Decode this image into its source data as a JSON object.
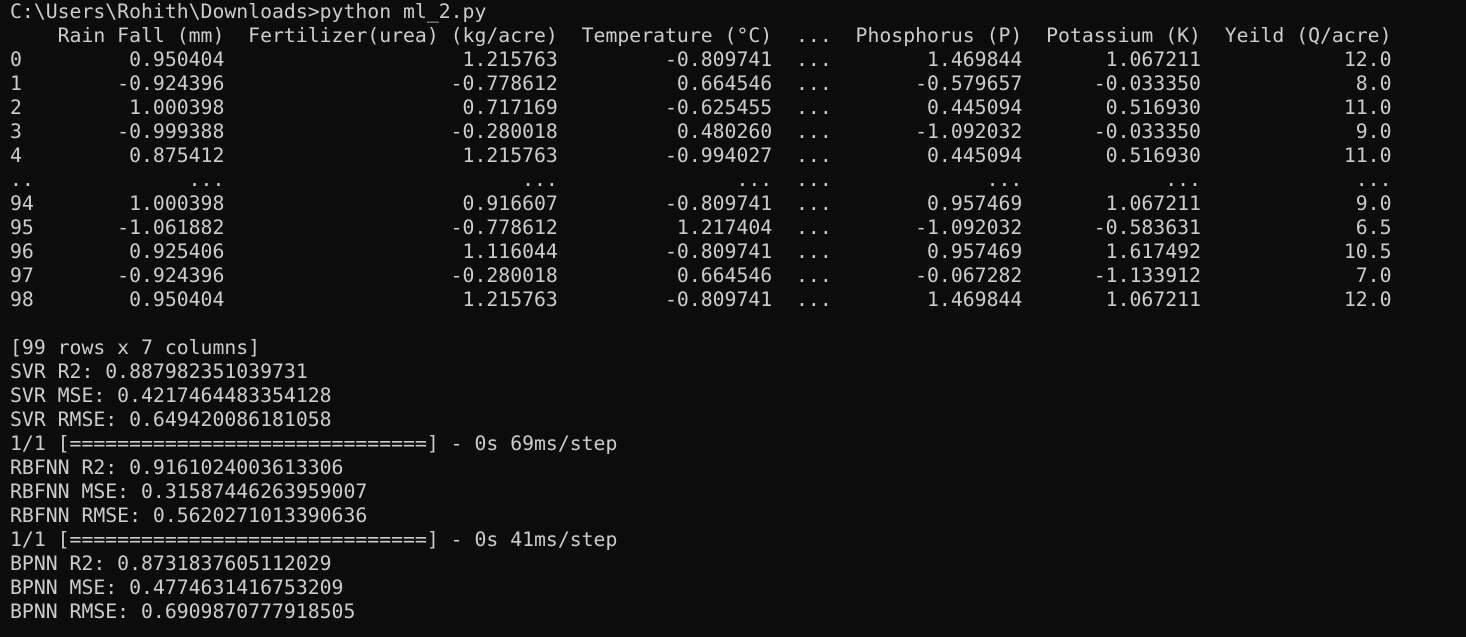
{
  "terminal": {
    "prompt": "C:\\Users\\Rohith\\Downloads>python ml_2.py",
    "table": {
      "header": "    Rain Fall (mm)  Fertilizer(urea) (kg/acre)  Temperature (°C)  ...  Phosphorus (P)  Potassium (K)  Yeild (Q/acre)",
      "rows": [
        "0         0.950404                    1.215763         -0.809741  ...        1.469844       1.067211            12.0",
        "1        -0.924396                   -0.778612          0.664546  ...       -0.579657      -0.033350             8.0",
        "2         1.000398                    0.717169         -0.625455  ...        0.445094       0.516930            11.0",
        "3        -0.999388                   -0.280018          0.480260  ...       -1.092032      -0.033350             9.0",
        "4         0.875412                    1.215763         -0.994027  ...        0.445094       0.516930            11.0",
        "..             ...                         ...               ...  ...             ...            ...             ...",
        "94        1.000398                    0.916607         -0.809741  ...        0.957469       1.067211             9.0",
        "95       -1.061882                   -0.778612          1.217404  ...       -1.092032      -0.583631             6.5",
        "96        0.925406                    1.116044         -0.809741  ...        0.957469       1.617492            10.5",
        "97       -0.924396                   -0.280018          0.664546  ...       -0.067282      -1.133912             7.0",
        "98        0.950404                    1.215763         -0.809741  ...        1.469844       1.067211            12.0"
      ],
      "summary": "[99 rows x 7 columns]"
    },
    "svr": {
      "r2": "SVR R2: 0.887982351039731",
      "mse": "SVR MSE: 0.4217464483354128",
      "rmse": "SVR RMSE: 0.649420086181058"
    },
    "progress_rbfnn": "1/1 [==============================] - 0s 69ms/step",
    "rbfnn": {
      "r2": "RBFNN R2: 0.9161024003613306",
      "mse": "RBFNN MSE: 0.31587446263959007",
      "rmse": "RBFNN RMSE: 0.5620271013390636"
    },
    "progress_bpnn": "1/1 [==============================] - 0s 41ms/step",
    "bpnn": {
      "r2": "BPNN R2: 0.8731837605112029",
      "mse": "BPNN MSE: 0.4774631416753209",
      "rmse": "BPNN RMSE: 0.6909870777918505"
    },
    "colors": {
      "background": "#0c0c0c",
      "foreground": "#cccccc"
    }
  }
}
